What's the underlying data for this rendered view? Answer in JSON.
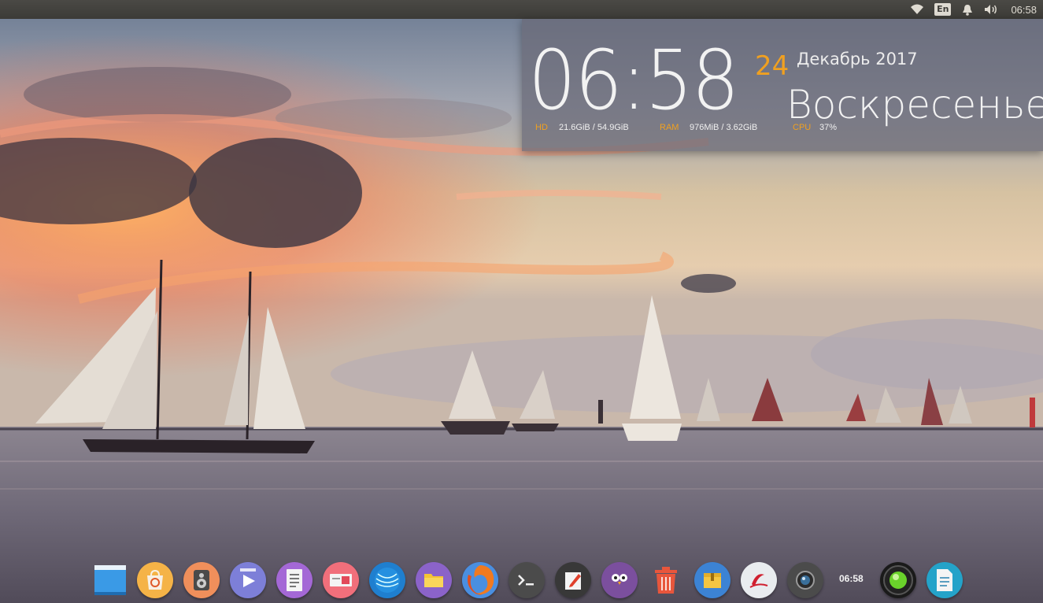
{
  "top_panel": {
    "icons": [
      "wifi-icon",
      "notification-bell-icon",
      "volume-icon"
    ],
    "language": "En",
    "clock": "06:58"
  },
  "clock_widget": {
    "time": "06:58",
    "day": "24",
    "month_year": "Декабрь 2017",
    "weekday": "Воскресенье",
    "accent_color": "#f0a020",
    "stats": {
      "hd_label": "HD",
      "hd_value": "21.6GiB / 54.9GiB",
      "ram_label": "RAM",
      "ram_value": "976MiB  / 3.62GiB",
      "cpu_label": "CPU",
      "cpu_value": "37%"
    }
  },
  "dock": {
    "items": [
      {
        "icon": "show-desktop-icon"
      },
      {
        "icon": "software-center-icon"
      },
      {
        "icon": "speaker-player-icon"
      },
      {
        "icon": "video-player-icon"
      },
      {
        "icon": "text-document-icon"
      },
      {
        "icon": "slides-presentation-icon"
      },
      {
        "icon": "browser-globe-icon"
      },
      {
        "icon": "files-folder-icon"
      },
      {
        "icon": "firefox-icon"
      },
      {
        "icon": "terminal-icon"
      },
      {
        "icon": "notes-editor-icon"
      },
      {
        "icon": "owl-chat-icon"
      },
      {
        "icon": "trash-icon"
      },
      {
        "icon": "archive-manager-icon"
      },
      {
        "icon": "ebook-reader-icon"
      },
      {
        "icon": "camera-icon"
      },
      {
        "icon": "green-orb-icon"
      },
      {
        "icon": "document-viewer-icon"
      }
    ],
    "clock": "06:58"
  }
}
